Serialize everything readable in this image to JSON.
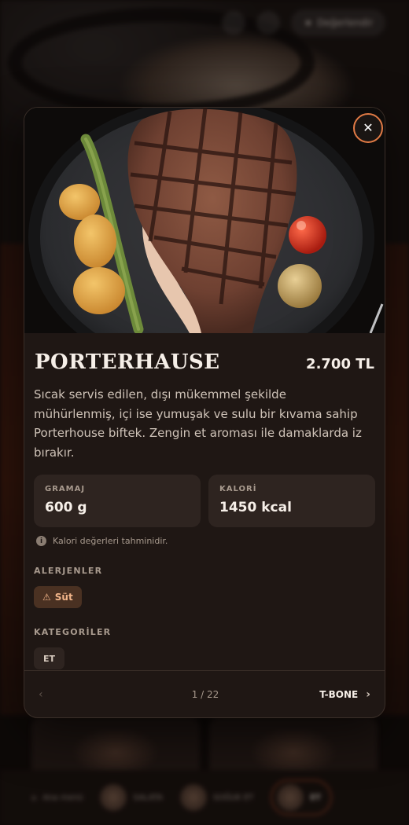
{
  "background": {
    "topbar": {
      "action_label": "Değerlendir"
    },
    "bottom_nav": [
      {
        "label": "Ana menü"
      },
      {
        "label": "SALATA"
      },
      {
        "label": "SOĞUK ET"
      },
      {
        "label": "ET"
      }
    ]
  },
  "modal": {
    "close_icon": "close-icon",
    "title": "PORTERHAUSE",
    "price": "2.700 TL",
    "description": "Sıcak servis edilen, dışı mükemmel şekilde mühürlenmiş, içi ise yumuşak ve sulu bir kıvama sahip Porterhouse biftek. Zengin et aroması ile damaklarda iz bırakır.",
    "stats": [
      {
        "label": "GRAMAJ",
        "value": "600 g"
      },
      {
        "label": "KALORİ",
        "value": "1450 kcal"
      }
    ],
    "note": "Kalori değerleri tahminidir.",
    "allergens_label": "ALERJENLER",
    "allergens": [
      {
        "icon": "warning-icon",
        "label": "Süt"
      }
    ],
    "categories_label": "KATEGORİLER",
    "categories": [
      "ET"
    ],
    "pagination": {
      "counter": "1 / 22",
      "next_label": "T-BONE"
    }
  },
  "colors": {
    "accent": "#e07a45",
    "modal_bg": "#1f1714",
    "chip_allergen_bg": "#4a3122"
  }
}
